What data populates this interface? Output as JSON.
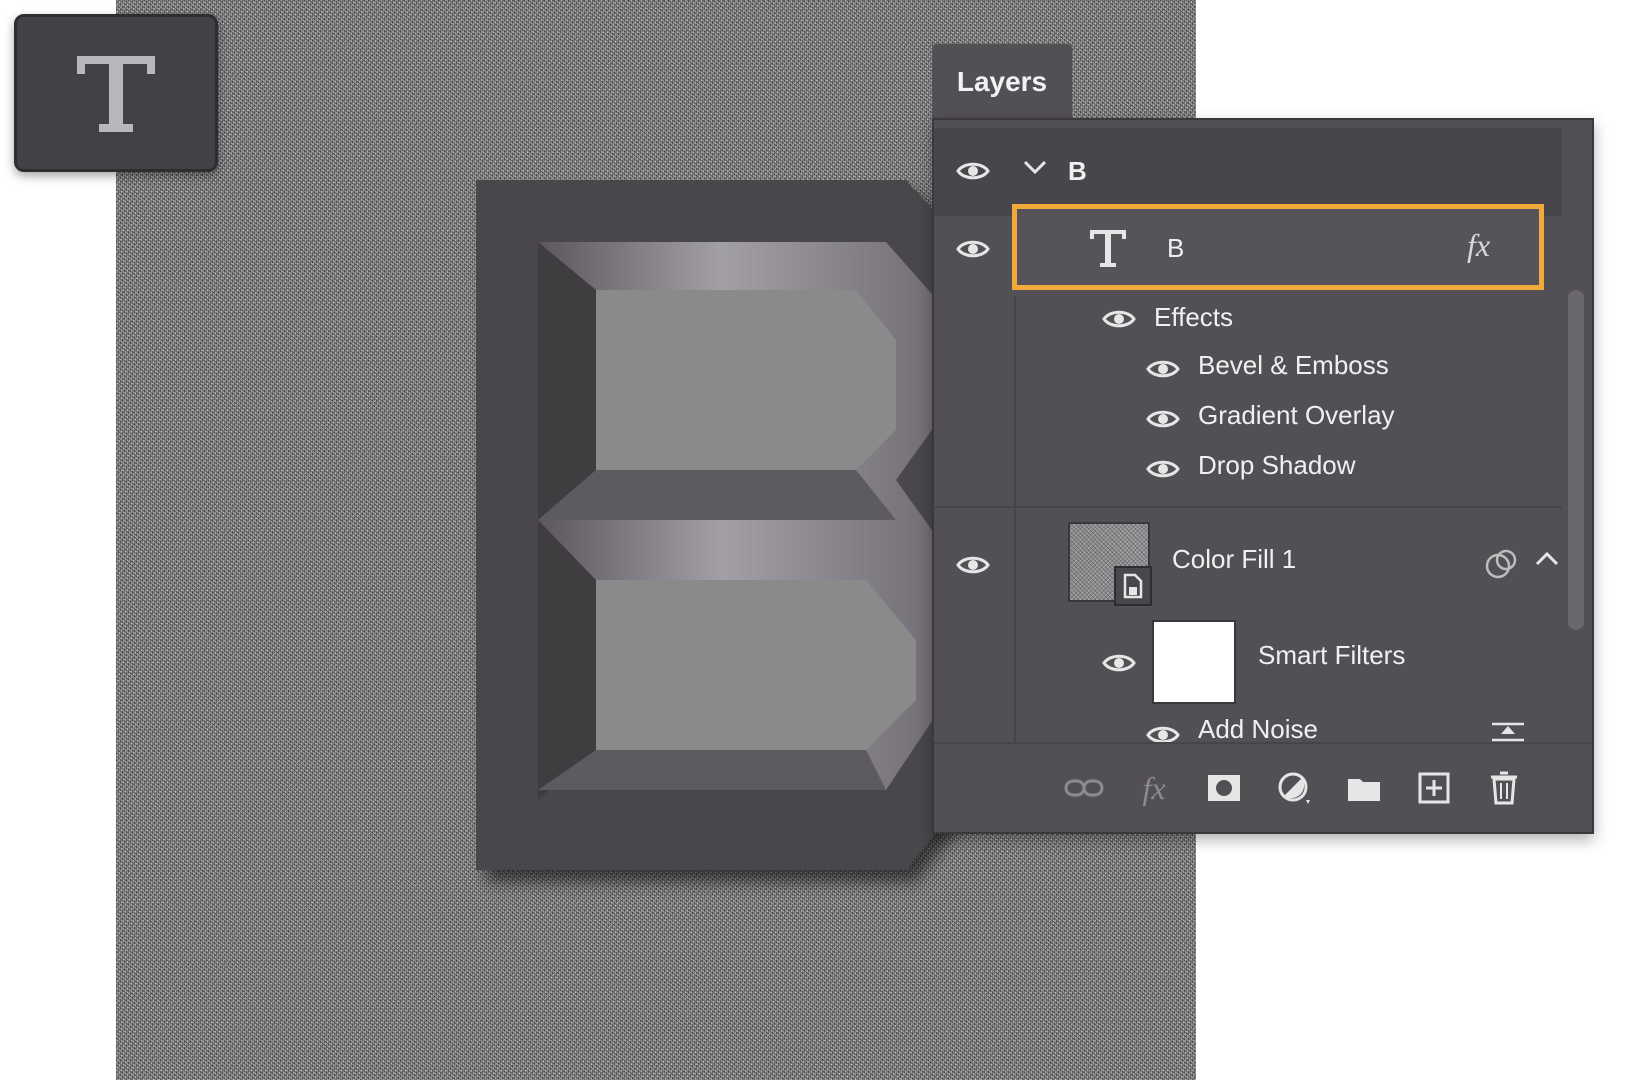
{
  "panel": {
    "tab_title": "Layers",
    "group": {
      "name": "B"
    },
    "selected_layer": {
      "name": "B",
      "fx_label": "fx"
    },
    "effects": {
      "label": "Effects",
      "items": [
        "Bevel & Emboss",
        "Gradient Overlay",
        "Drop Shadow"
      ]
    },
    "fill_layer": {
      "name": "Color Fill 1"
    },
    "smart_filters": {
      "label": "Smart Filters",
      "items": [
        "Add Noise"
      ]
    },
    "footer_fx_label": "fx"
  },
  "colors": {
    "selection_outline": "#f1a93a",
    "panel_bg": "#535055",
    "tool_tile_bg": "#434046"
  },
  "icons": {
    "tool_tile": "type-tool-icon",
    "footer": [
      "link-icon",
      "fx-icon",
      "mask-icon",
      "adjustment-icon",
      "folder-icon",
      "new-layer-icon",
      "trash-icon"
    ]
  }
}
